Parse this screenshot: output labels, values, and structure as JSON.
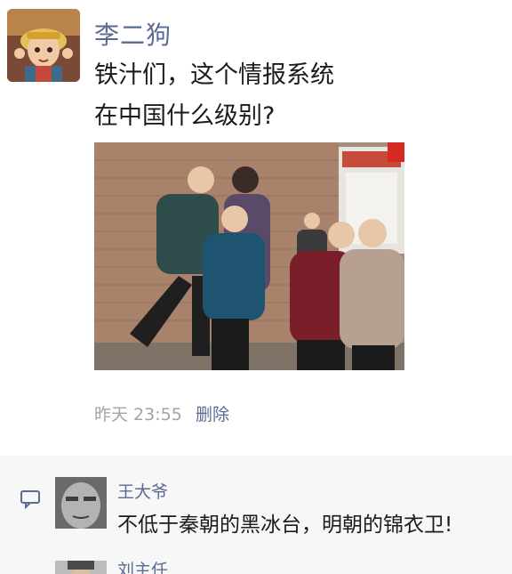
{
  "post": {
    "username": "李二狗",
    "text_line1": "铁汁们，这个情报系统",
    "text_line2": "在中国什么级别?",
    "time": "昨天 23:55",
    "delete_label": "删除"
  },
  "comments": [
    {
      "name": "王大爷",
      "text": "不低于秦朝的黑冰台，明朝的锦衣卫!"
    },
    {
      "name": "刘主任",
      "text": ""
    }
  ],
  "icons": {
    "comment": "speech-bubble-icon"
  },
  "colors": {
    "name_link": "#5b6b94",
    "timestamp": "#a3a3a3",
    "comment_bg": "#f7f7f7"
  }
}
